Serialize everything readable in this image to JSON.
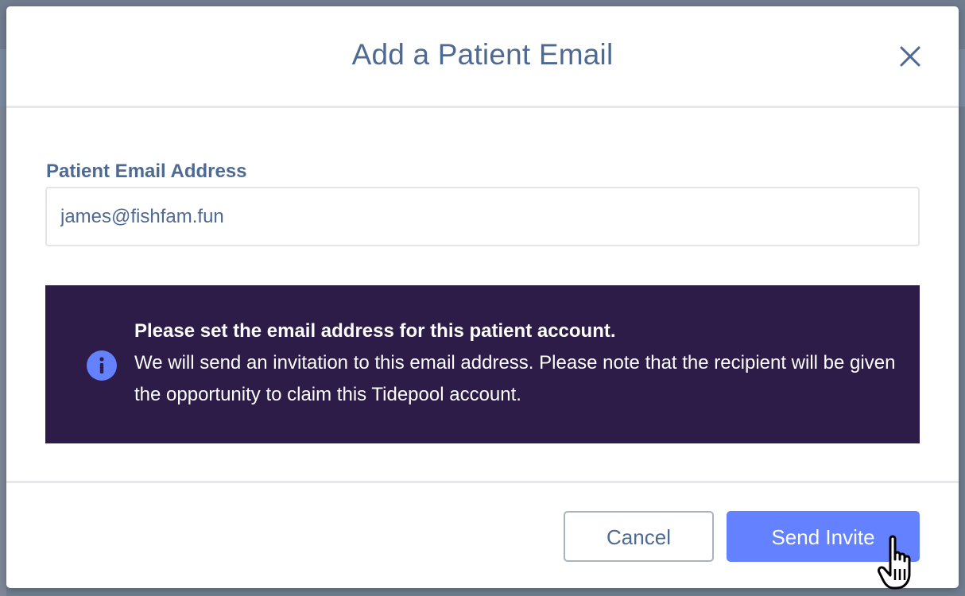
{
  "modal": {
    "title": "Add a Patient Email",
    "close_icon": "close-icon"
  },
  "form": {
    "email_label": "Patient Email Address",
    "email_value": "james@fishfam.fun"
  },
  "info_banner": {
    "icon": "info-icon",
    "heading": "Please set the email address for this patient account.",
    "message": "We will send an invitation to this email address. Please note that the recipient will be given the opportunity to claim this Tidepool account.",
    "background_color": "#2d1b48",
    "icon_color": "#6481ff"
  },
  "footer": {
    "cancel_label": "Cancel",
    "send_label": "Send Invite",
    "primary_color": "#6481ff"
  },
  "cursor": {
    "icon": "hand-pointer-icon"
  }
}
